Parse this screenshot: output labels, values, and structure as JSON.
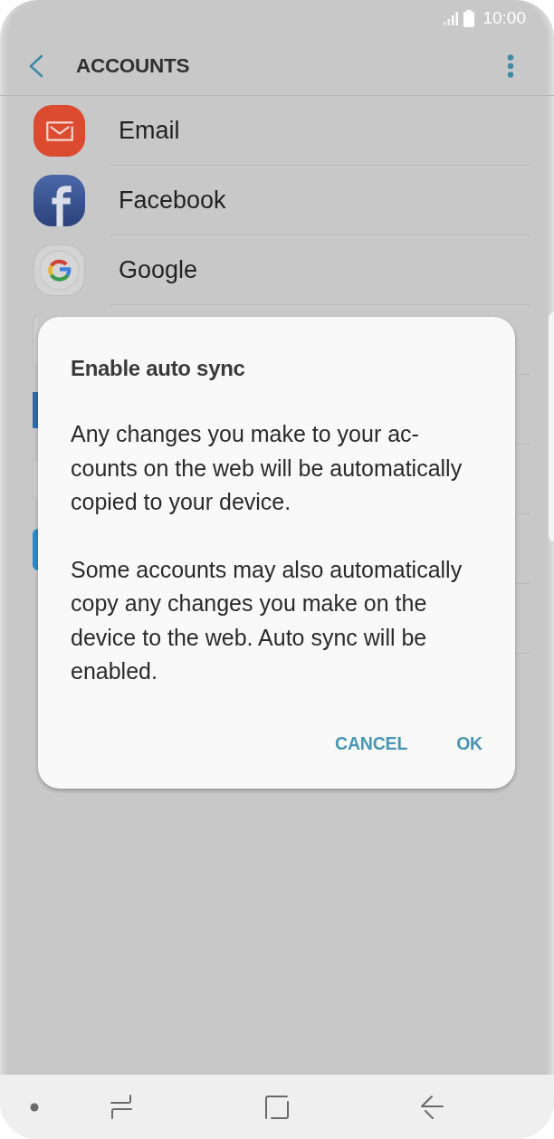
{
  "status_bar": {
    "time": "10:00"
  },
  "header": {
    "title": "ACCOUNTS"
  },
  "accounts": [
    {
      "kind": "email",
      "label": "Email"
    },
    {
      "kind": "facebook",
      "label": "Facebook"
    },
    {
      "kind": "google",
      "label": "Google"
    },
    {
      "kind": "covered_tile"
    },
    {
      "kind": "covered_blue_tile"
    },
    {
      "kind": "covered_circle"
    },
    {
      "kind": "covered_blue_circle"
    },
    {
      "kind": "covered"
    }
  ],
  "dialog": {
    "title": "Enable auto sync",
    "paragraphs": [
      "Any changes you make to your ac-\ncounts on the web will be automatically\ncopied to your device.",
      "Some accounts may also automatically\ncopy any changes you make on the\ndevice to the web. Auto sync will be\nenabled."
    ],
    "buttons": [
      {
        "label": "CANCEL"
      },
      {
        "label": "OK"
      }
    ]
  }
}
